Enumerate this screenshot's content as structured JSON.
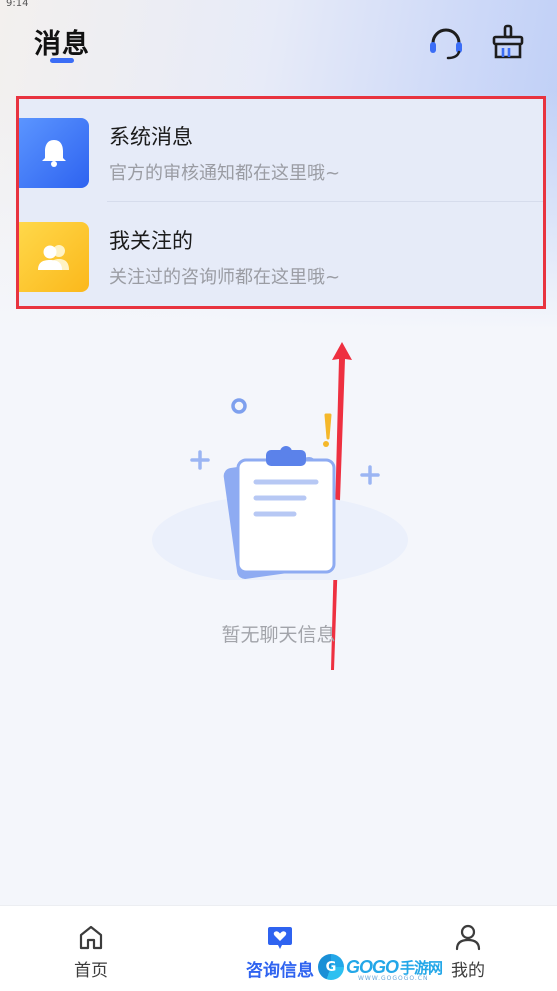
{
  "status_bar": {
    "time": "9:14"
  },
  "header": {
    "title": "消息",
    "support_icon": "headset-icon",
    "clear_icon": "broom-icon"
  },
  "messages": [
    {
      "title": "系统消息",
      "subtitle": "官方的审核通知都在这里哦~",
      "icon": "bell-icon",
      "color": "#3a74f5"
    },
    {
      "title": "我关注的",
      "subtitle": "关注过的咨询师都在这里哦~",
      "icon": "users-icon",
      "color": "#fcc32a"
    }
  ],
  "empty_state": {
    "text": "暂无聊天信息",
    "icon": "clipboard-icon"
  },
  "bottom_nav": {
    "tabs": [
      {
        "label": "首页",
        "icon": "home-icon",
        "active": false
      },
      {
        "label": "咨询信息",
        "icon": "heart-chat-icon",
        "active": true
      },
      {
        "label": "我的",
        "icon": "user-icon",
        "active": false
      }
    ]
  },
  "watermark": {
    "brand": "GOGO",
    "cn": "手游网",
    "domain": "WWW.GOGOGO.CN"
  },
  "colors": {
    "accent": "#2f63f0",
    "highlight_border": "#e8333f",
    "arrow": "#ee3040"
  }
}
